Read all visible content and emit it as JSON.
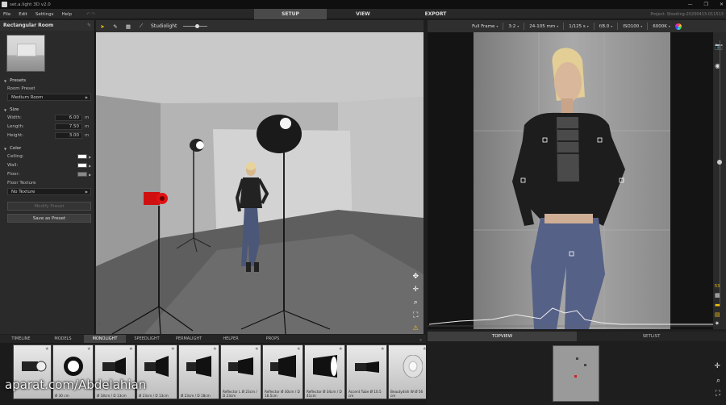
{
  "titlebar": {
    "title": "set.a.light 3D v2.0",
    "min": "—",
    "max": "❐",
    "close": "✕"
  },
  "menu": {
    "items": [
      "File",
      "Edit",
      "Settings",
      "Help"
    ],
    "undo": "↶  ↷"
  },
  "main_tabs": [
    "SETUP",
    "VIEW",
    "EXPORT"
  ],
  "project": "Project: Shooting-20200413-011513",
  "left_panel": {
    "title": "Rectangular Room",
    "presets_section": "Presets",
    "room_preset_label": "Room Preset",
    "room_preset_value": "Medium Room",
    "size_section": "Size",
    "width_label": "Width:",
    "width_value": "6.00",
    "width_unit": "m",
    "length_label": "Length:",
    "length_value": "7.50",
    "length_unit": "m",
    "height_label": "Height:",
    "height_value": "3.00",
    "height_unit": "m",
    "color_section": "Color",
    "ceiling_label": "Ceiling:",
    "wall_label": "Wall:",
    "floor_label": "Floor:",
    "ceiling_color": "#ffffff",
    "wall_color": "#ffffff",
    "floor_color": "#8a8a8a",
    "floor_texture_label": "Floor Texture",
    "floor_texture_value": "No Texture",
    "modify_preset": "Modify Preset",
    "save_as_preset": "Save as Preset"
  },
  "viewport_toolbar": {
    "label": "Studiolight"
  },
  "camera_toolbar": {
    "frame": "Full Frame",
    "ratio": "3:2",
    "lens": "24-105 mm",
    "shutter": "1/125 s",
    "aperture": "f/8.0",
    "iso": "ISO100",
    "wb": "6000K"
  },
  "camera_side": {
    "zoom_label": "53"
  },
  "bottom_tabs": [
    "TIMELINE",
    "MODELS",
    "MONOLIGHT",
    "SPEEDLIGHT",
    "PERMALIGHT",
    "HELPER",
    "PROPS"
  ],
  "lights": [
    {
      "label": ""
    },
    {
      "label": "Ø 30 cm"
    },
    {
      "label": "Ø 18cm / D 13cm"
    },
    {
      "label": "Ø 23cm / D 13cm"
    },
    {
      "label": "Ø 23cm / D 18cm"
    },
    {
      "label": "Reflector L Ø 23cm / D 23cm"
    },
    {
      "label": "Reflector Ø 30cm / D 18.5cm"
    },
    {
      "label": "Reflector Ø 34cm / D 41cm"
    },
    {
      "label": "Accent Tube Ø 10.5 cm"
    },
    {
      "label": "Beautydish W Ø 56 cm"
    }
  ],
  "right_bottom_tabs": [
    "TOPVIEW",
    "SETLIST"
  ],
  "watermark": "aparat.com/Abdelahian"
}
